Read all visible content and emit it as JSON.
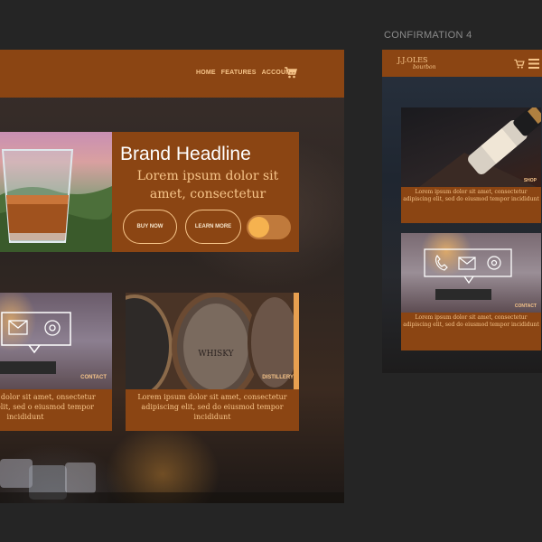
{
  "desktop": {
    "nav": {
      "home": "HOME",
      "features": "FEATURES",
      "account": "ACCOUNT"
    },
    "hero": {
      "headline": "Brand Headline",
      "sub": "Lorem ipsum dolor sit amet, consectetur",
      "buy_now": "BUY NOW",
      "learn_more": "LEARN MORE"
    },
    "cards": [
      {
        "tag": "CONTACT",
        "text": "orem ipsum dolor sit amet, onsectetur adipiscing elit, sed o eiusmod tempor incididunt"
      },
      {
        "tag": "DISTILLERY",
        "text": "Lorem ipsum dolor sit amet, consectetur adipiscing elit, sed do eiusmod tempor incididunt"
      }
    ]
  },
  "mobile": {
    "label": "CONFIRMATION 4",
    "logo": "J.J.OLES",
    "logo_sub": "bourbon",
    "cards": [
      {
        "tag": "SHOP",
        "text": "Lorem ipsum dolor sit amet, consectetur adipiscing elit, sed do eiusmod tempor incididunt"
      },
      {
        "tag": "CONTACT",
        "text": "Lorem ipsum dolor sit amet, consectetur adipiscing elit, sed do eiusmod tempor incididunt"
      }
    ]
  },
  "colors": {
    "brown": "#8b4513",
    "gold": "#f7c58a",
    "bg": "#252525"
  }
}
